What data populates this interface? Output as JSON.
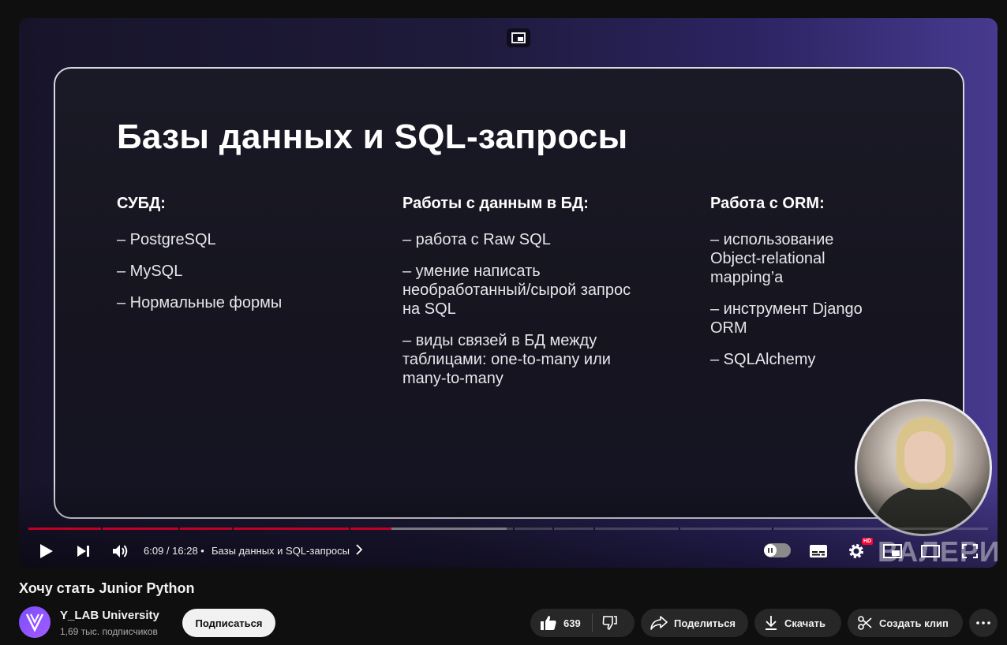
{
  "slide": {
    "title": "Базы данных и SQL-запросы",
    "columns": [
      {
        "heading": "СУБД:",
        "items": [
          "– PostgreSQL",
          "– MySQL",
          "– Нормальные формы"
        ]
      },
      {
        "heading": "Работы с данным в БД:",
        "items": [
          "– работа с Raw SQL",
          "– умение написать необработанный/сырой запрос на SQL",
          "– виды связей в БД между таблицами: one-to-many или many-to-many"
        ]
      },
      {
        "heading": "Работа с ORM:",
        "items": [
          "– использование Object-relational mapping’a",
          "– инструмент Django ORM",
          "– SQLAlchemy"
        ]
      }
    ]
  },
  "player": {
    "time": "6:09 / 16:28",
    "separator": "•",
    "chapter": "Базы данных и SQL-запросы",
    "hd_badge": "HD",
    "watermark": "ВАЛЕРИЯ",
    "progress_played": 0.378,
    "progress_buffered": 0.498,
    "accent_color": "#ff0033",
    "icons": [
      "miniplayer-icon",
      "play-icon",
      "next-icon",
      "volume-icon",
      "chevron-right-icon",
      "autoplay-toggle",
      "subtitles-icon",
      "settings-icon",
      "miniplayer-icon",
      "theater-icon",
      "fullscreen-icon"
    ]
  },
  "video": {
    "title": "Хочу стать Junior Python",
    "channel_name": "Y_LAB University",
    "subscribers": "1,69 тыс. подписчиков",
    "subscribe_label": "Подписаться",
    "likes": "639",
    "share_label": "Поделиться",
    "download_label": "Скачать",
    "clip_label": "Создать клип"
  }
}
